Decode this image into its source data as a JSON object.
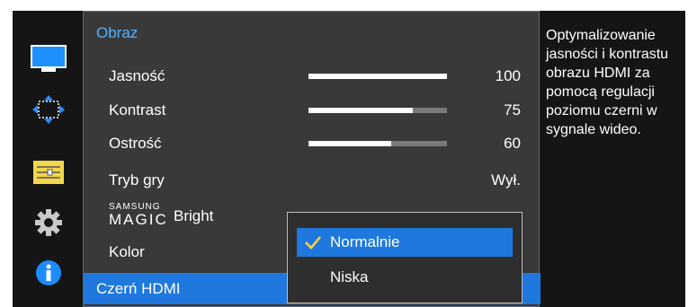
{
  "menu": {
    "title": "Obraz",
    "items": [
      {
        "label": "Jasność",
        "value": "100",
        "level": 1.0
      },
      {
        "label": "Kontrast",
        "value": "75",
        "level": 0.75
      },
      {
        "label": "Ostrość",
        "value": "60",
        "level": 0.6
      },
      {
        "label": "Tryb gry",
        "value": "Wył."
      },
      {
        "label_prefix": "SAMSUNG",
        "label_magic": "MAGIC",
        "label_suffix": "Bright"
      },
      {
        "label": "Kolor"
      },
      {
        "label": "Czerń HDMI",
        "selected": true
      }
    ]
  },
  "dropdown": {
    "options": [
      {
        "label": "Normalnie",
        "selected": true
      },
      {
        "label": "Niska",
        "selected": false
      }
    ]
  },
  "description": "Optymalizowanie jasności i kontrastu obrazu HDMI za pomocą regulacji poziomu czerni w sygnale wideo.",
  "rail": {
    "icons": [
      "monitor-icon",
      "screen-adjust-icon",
      "system-sliders-icon",
      "settings-gear-icon",
      "info-icon"
    ]
  },
  "colors": {
    "accent": "#1f78dd",
    "title": "#55b2ff",
    "panel": "#393939",
    "background": "#151515"
  }
}
